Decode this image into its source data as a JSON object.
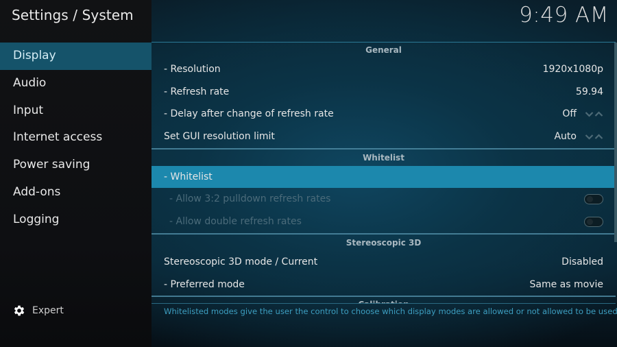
{
  "header": {
    "title": "Settings / System",
    "clock": "9:49 AM"
  },
  "sidebar": {
    "items": [
      {
        "label": "Display",
        "active": true
      },
      {
        "label": "Audio"
      },
      {
        "label": "Input"
      },
      {
        "label": "Internet access"
      },
      {
        "label": "Power saving"
      },
      {
        "label": "Add-ons"
      },
      {
        "label": "Logging"
      }
    ],
    "expert": {
      "label": "Expert",
      "icon": "gear-icon"
    }
  },
  "sections": {
    "general": {
      "title": "General",
      "rows": [
        {
          "label": "- Resolution",
          "value": "1920x1080p"
        },
        {
          "label": "- Refresh rate",
          "value": "59.94"
        },
        {
          "label": "- Delay after change of refresh rate",
          "value": "Off",
          "control": "spinner"
        },
        {
          "label": "Set GUI resolution limit",
          "value": "Auto",
          "control": "spinner"
        }
      ]
    },
    "whitelist": {
      "title": "Whitelist",
      "rows": [
        {
          "label": "- Whitelist",
          "focused": true
        },
        {
          "label": "- Allow 3:2 pulldown refresh rates",
          "control": "toggle",
          "state": "off",
          "disabled": true
        },
        {
          "label": "- Allow double refresh rates",
          "control": "toggle",
          "state": "off",
          "disabled": true
        }
      ]
    },
    "stereo": {
      "title": "Stereoscopic 3D",
      "rows": [
        {
          "label": "Stereoscopic 3D mode / Current",
          "value": "Disabled"
        },
        {
          "label": "- Preferred mode",
          "value": "Same as movie"
        }
      ]
    },
    "calibration": {
      "title": "Calibration"
    }
  },
  "description": "Whitelisted modes give the user the control to choose which display modes are allowed or not allowed to be used",
  "colors": {
    "accent_focus": "#1c88ad",
    "sidebar_active": "#15536a",
    "description_text": "#3d9ec0"
  }
}
